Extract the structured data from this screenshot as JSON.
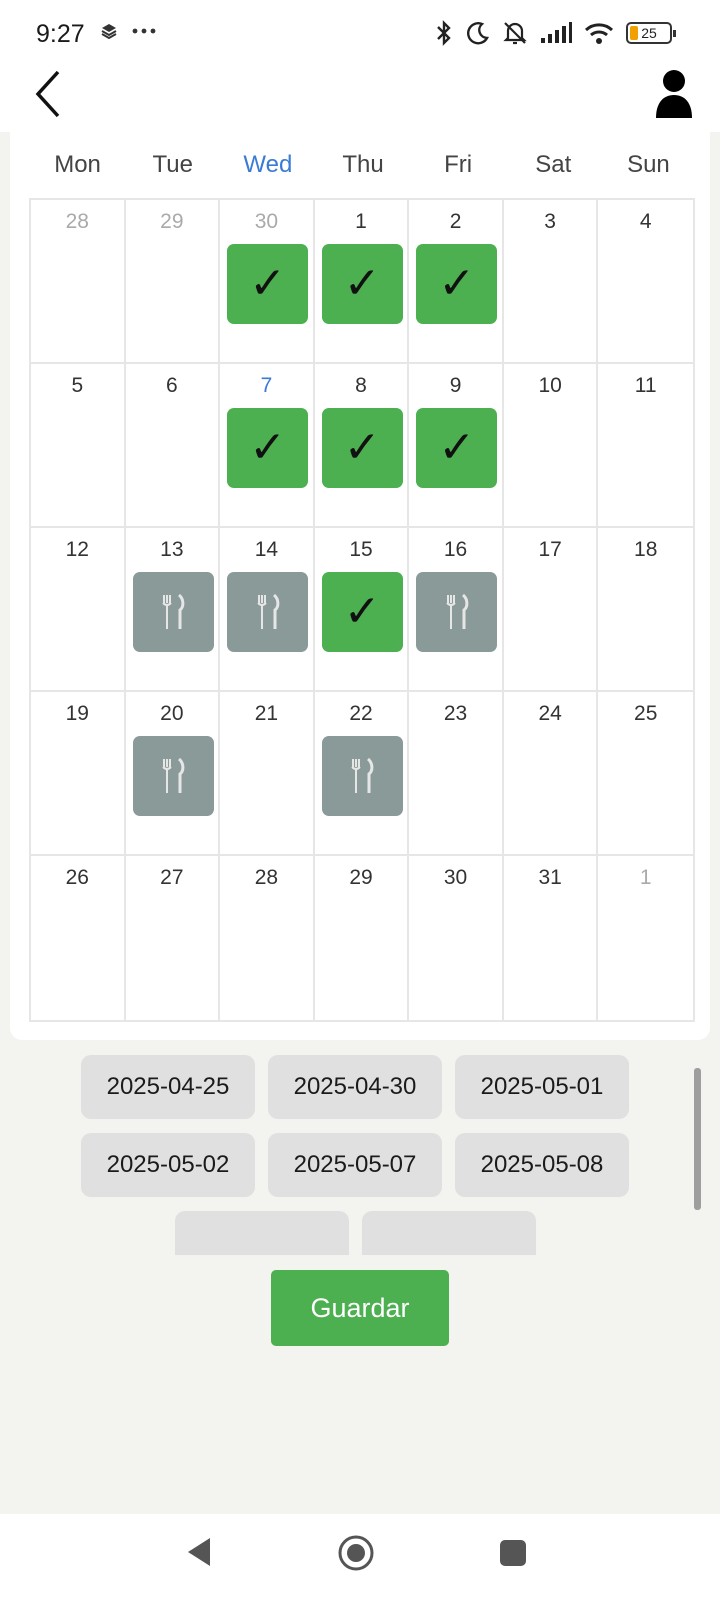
{
  "status_bar": {
    "time": "9:27",
    "battery": "25",
    "icons": [
      "layers-icon",
      "more-icon",
      "bluetooth-icon",
      "dnd-moon-icon",
      "silent-bell-icon",
      "signal-icon",
      "wifi-icon",
      "battery-icon"
    ]
  },
  "header": {
    "back_icon": "chevron-left-icon",
    "profile_icon": "person-icon"
  },
  "calendar": {
    "weekdays": [
      "Mon",
      "Tue",
      "Wed",
      "Thu",
      "Fri",
      "Sat",
      "Sun"
    ],
    "current_weekday": "Wed",
    "weeks": [
      [
        {
          "day": "28",
          "muted": true
        },
        {
          "day": "29",
          "muted": true
        },
        {
          "day": "30",
          "muted": true,
          "status": "check"
        },
        {
          "day": "1",
          "status": "check"
        },
        {
          "day": "2",
          "status": "check"
        },
        {
          "day": "3"
        },
        {
          "day": "4"
        }
      ],
      [
        {
          "day": "5"
        },
        {
          "day": "6"
        },
        {
          "day": "7",
          "today": true,
          "status": "check"
        },
        {
          "day": "8",
          "status": "check"
        },
        {
          "day": "9",
          "status": "check"
        },
        {
          "day": "10"
        },
        {
          "day": "11"
        }
      ],
      [
        {
          "day": "12"
        },
        {
          "day": "13",
          "status": "meal"
        },
        {
          "day": "14",
          "status": "meal"
        },
        {
          "day": "15",
          "status": "check"
        },
        {
          "day": "16",
          "status": "meal"
        },
        {
          "day": "17"
        },
        {
          "day": "18"
        }
      ],
      [
        {
          "day": "19"
        },
        {
          "day": "20",
          "status": "meal"
        },
        {
          "day": "21"
        },
        {
          "day": "22",
          "status": "meal"
        },
        {
          "day": "23"
        },
        {
          "day": "24"
        },
        {
          "day": "25"
        }
      ],
      [
        {
          "day": "26"
        },
        {
          "day": "27"
        },
        {
          "day": "28"
        },
        {
          "day": "29"
        },
        {
          "day": "30"
        },
        {
          "day": "31"
        },
        {
          "day": "1",
          "muted": true
        }
      ]
    ],
    "check_glyph": "✓"
  },
  "selected_dates": [
    "2025-04-25",
    "2025-04-30",
    "2025-05-01",
    "2025-05-02",
    "2025-05-07",
    "2025-05-08",
    "",
    ""
  ],
  "save_label": "Guardar",
  "colors": {
    "check": "#4caf50",
    "meal": "#8a9a99",
    "today": "#3a7bd5"
  }
}
